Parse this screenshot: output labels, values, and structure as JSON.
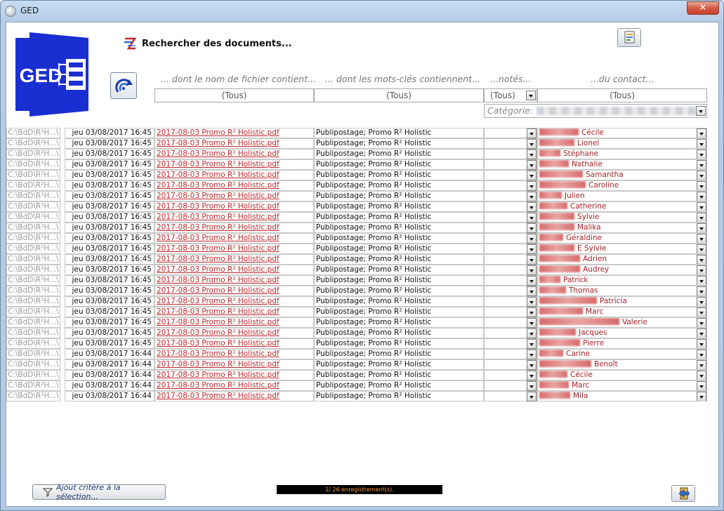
{
  "window": {
    "title": "GED",
    "close_label": "✕"
  },
  "logo": {
    "text": "GED",
    "color": "#1a2fd1"
  },
  "search": {
    "title": "Rechercher des documents..."
  },
  "headers": {
    "filename": "... dont le nom de fichier contient...",
    "keywords": "... dont les mots-clés contiennent...",
    "notes": "...notés...",
    "contact": "...du contact..."
  },
  "filters": {
    "filename": "(Tous)",
    "keywords": "(Tous)",
    "notes": "(Tous)",
    "contact": "(Tous)"
  },
  "categorie": {
    "label": "Catégorie:"
  },
  "rows": [
    {
      "path": "C:\\BdD\\R²H...\\",
      "date": "jeu 03/08/2017 16:45",
      "file": "2017-08-03 Promo R² Holistic.pdf",
      "keywords": "Publipostage; Promo R² Holistic",
      "contact": "Cécile"
    },
    {
      "path": "C:\\BdD\\R²H...\\",
      "date": "jeu 03/08/2017 16:45",
      "file": "2017-08-03 Promo R² Holistic.pdf",
      "keywords": "Publipostage; Promo R² Holistic",
      "contact": "Lionel"
    },
    {
      "path": "C:\\BdD\\R²H...\\",
      "date": "jeu 03/08/2017 16:45",
      "file": "2017-08-03 Promo R² Holistic.pdf",
      "keywords": "Publipostage; Promo R² Holistic",
      "contact": "Stéphane"
    },
    {
      "path": "C:\\BdD\\R²H...\\",
      "date": "jeu 03/08/2017 16:45",
      "file": "2017-08-03 Promo R² Holistic.pdf",
      "keywords": "Publipostage; Promo R² Holistic",
      "contact": "Nathalie"
    },
    {
      "path": "C:\\BdD\\R²H...\\",
      "date": "jeu 03/08/2017 16:45",
      "file": "2017-08-03 Promo R² Holistic.pdf",
      "keywords": "Publipostage; Promo R² Holistic",
      "contact": "Samantha"
    },
    {
      "path": "C:\\BdD\\R²H...\\",
      "date": "jeu 03/08/2017 16:45",
      "file": "2017-08-03 Promo R² Holistic.pdf",
      "keywords": "Publipostage; Promo R² Holistic",
      "contact": "Caroline"
    },
    {
      "path": "C:\\BdD\\R²H...\\",
      "date": "jeu 03/08/2017 16:45",
      "file": "2017-08-03 Promo R² Holistic.pdf",
      "keywords": "Publipostage; Promo R² Holistic",
      "contact": "Julien"
    },
    {
      "path": "C:\\BdD\\R²H...\\",
      "date": "jeu 03/08/2017 16:45",
      "file": "2017-08-03 Promo R² Holistic.pdf",
      "keywords": "Publipostage; Promo R² Holistic",
      "contact": "Catherine"
    },
    {
      "path": "C:\\BdD\\R²H...\\",
      "date": "jeu 03/08/2017 16:45",
      "file": "2017-08-03 Promo R² Holistic.pdf",
      "keywords": "Publipostage; Promo R² Holistic",
      "contact": "Sylvie"
    },
    {
      "path": "C:\\BdD\\R²H...\\",
      "date": "jeu 03/08/2017 16:45",
      "file": "2017-08-03 Promo R² Holistic.pdf",
      "keywords": "Publipostage; Promo R² Holistic",
      "contact": "Malika"
    },
    {
      "path": "C:\\BdD\\R²H...\\",
      "date": "jeu 03/08/2017 16:45",
      "file": "2017-08-03 Promo R² Holistic.pdf",
      "keywords": "Publipostage; Promo R² Holistic",
      "contact": "Géraldine"
    },
    {
      "path": "C:\\BdD\\R²H...\\",
      "date": "jeu 03/08/2017 16:45",
      "file": "2017-08-03 Promo R² Holistic.pdf",
      "keywords": "Publipostage; Promo R² Holistic",
      "contact": "E Sylvie"
    },
    {
      "path": "C:\\BdD\\R²H...\\",
      "date": "jeu 03/08/2017 16:45",
      "file": "2017-08-03 Promo R² Holistic.pdf",
      "keywords": "Publipostage; Promo R² Holistic",
      "contact": "Adrien"
    },
    {
      "path": "C:\\BdD\\R²H...\\",
      "date": "jeu 03/08/2017 16:45",
      "file": "2017-08-03 Promo R² Holistic.pdf",
      "keywords": "Publipostage; Promo R² Holistic",
      "contact": "Audrey"
    },
    {
      "path": "C:\\BdD\\R²H...\\",
      "date": "jeu 03/08/2017 16:45",
      "file": "2017-08-03 Promo R² Holistic.pdf",
      "keywords": "Publipostage; Promo R² Holistic",
      "contact": "Patrick"
    },
    {
      "path": "C:\\BdD\\R²H...\\",
      "date": "jeu 03/08/2017 16:45",
      "file": "2017-08-03 Promo R² Holistic.pdf",
      "keywords": "Publipostage; Promo R² Holistic",
      "contact": "Thomas"
    },
    {
      "path": "C:\\BdD\\R²H...\\",
      "date": "jeu 03/08/2017 16:45",
      "file": "2017-08-03 Promo R² Holistic.pdf",
      "keywords": "Publipostage; Promo R² Holistic",
      "contact": "Patricia"
    },
    {
      "path": "C:\\BdD\\R²H...\\",
      "date": "jeu 03/08/2017 16:45",
      "file": "2017-08-03 Promo R² Holistic.pdf",
      "keywords": "Publipostage; Promo R² Holistic",
      "contact": "Marc"
    },
    {
      "path": "C:\\BdD\\R²H...\\",
      "date": "jeu 03/08/2017 16:45",
      "file": "2017-08-03 Promo R² Holistic.pdf",
      "keywords": "Publipostage; Promo R² Holistic",
      "contact": "Valerie"
    },
    {
      "path": "C:\\BdD\\R²H...\\",
      "date": "jeu 03/08/2017 16:45",
      "file": "2017-08-03 Promo R² Holistic.pdf",
      "keywords": "Publipostage; Promo R² Holistic",
      "contact": "Jacques"
    },
    {
      "path": "C:\\BdD\\R²H...\\",
      "date": "jeu 03/08/2017 16:45",
      "file": "2017-08-03 Promo R² Holistic.pdf",
      "keywords": "Publipostage; Promo R² Holistic",
      "contact": "Pierre"
    },
    {
      "path": "C:\\BdD\\R²H...\\",
      "date": "jeu 03/08/2017 16:44",
      "file": "2017-08-03 Promo R² Holistic.pdf",
      "keywords": "Publipostage; Promo R² Holistic",
      "contact": "Carine"
    },
    {
      "path": "C:\\BdD\\R²H...\\",
      "date": "jeu 03/08/2017 16:44",
      "file": "2017-08-03 Promo R² Holistic.pdf",
      "keywords": "Publipostage; Promo R² Holistic",
      "contact": "Benoît"
    },
    {
      "path": "C:\\BdD\\R²H...\\",
      "date": "jeu 03/08/2017 16:44",
      "file": "2017-08-03 Promo R² Holistic.pdf",
      "keywords": "Publipostage; Promo R² Holistic",
      "contact": "Cécile"
    },
    {
      "path": "C:\\BdD\\R²H...\\",
      "date": "jeu 03/08/2017 16:44",
      "file": "2017-08-03 Promo R² Holistic.pdf",
      "keywords": "Publipostage; Promo R² Holistic",
      "contact": "Marc"
    },
    {
      "path": "C:\\BdD\\R²H...\\",
      "date": "jeu 03/08/2017 16:44",
      "file": "2017-08-03 Promo R² Holistic.pdf",
      "keywords": "Publipostage; Promo R² Holistic",
      "contact": "Mila"
    }
  ],
  "footer": {
    "add_criteria_label": "Ajout critère à la sélection...",
    "status": "1/ 26 enregistrement(s)."
  },
  "icons": {
    "app": "app-icon",
    "search": "search-icon",
    "refresh": "refresh-icon",
    "report": "report-icon",
    "filter": "filter-icon",
    "exit": "exit-icon"
  }
}
